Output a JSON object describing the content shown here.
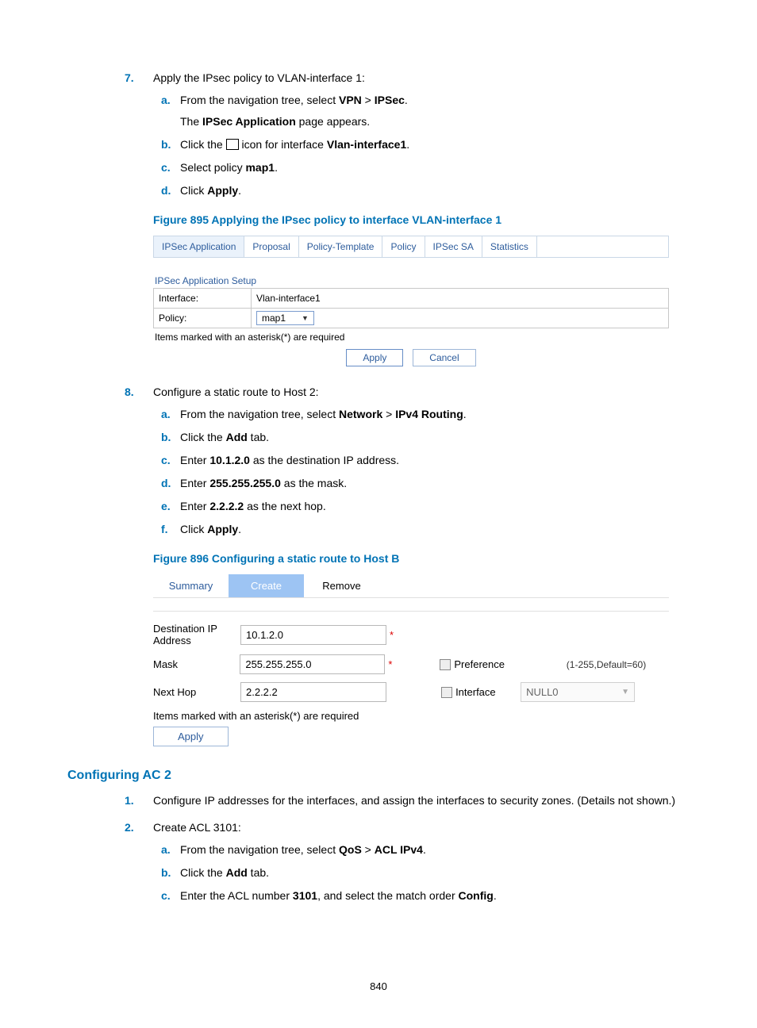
{
  "step7": {
    "number": "7.",
    "intro": "Apply the IPsec policy to VLAN-interface 1:",
    "a_pre": "From the navigation tree, select ",
    "a_b1": "VPN",
    "a_mid": " > ",
    "a_b2": "IPSec",
    "a_post": ".",
    "a_line2_pre": "The ",
    "a_line2_b": "IPSec Application",
    "a_line2_post": " page appears.",
    "b_pre": "Click the ",
    "b_mid": " icon for interface ",
    "b_b": "Vlan-interface1",
    "b_post": ".",
    "c_pre": "Select policy ",
    "c_b": "map1",
    "c_post": ".",
    "d_pre": "Click ",
    "d_b": "Apply",
    "d_post": "."
  },
  "fig895": {
    "caption": "Figure 895 Applying the IPsec policy to interface VLAN-interface 1",
    "tabs": [
      "IPSec Application",
      "Proposal",
      "Policy-Template",
      "Policy",
      "IPSec SA",
      "Statistics"
    ],
    "setup_title": "IPSec Application Setup",
    "row_interface_label": "Interface:",
    "row_interface_value": "Vlan-interface1",
    "row_policy_label": "Policy:",
    "row_policy_value": "map1",
    "note": "Items marked with an asterisk(*) are required",
    "apply": "Apply",
    "cancel": "Cancel"
  },
  "step8": {
    "number": "8.",
    "intro": "Configure a static route to Host 2:",
    "a_pre": "From the navigation tree, select ",
    "a_b1": "Network",
    "a_mid": " > ",
    "a_b2": "IPv4 Routing",
    "a_post": ".",
    "b_pre": "Click the ",
    "b_b": "Add",
    "b_post": " tab.",
    "c_pre": "Enter ",
    "c_b": "10.1.2.0",
    "c_post": " as the destination IP address.",
    "d_pre": "Enter ",
    "d_b": "255.255.255.0",
    "d_post": " as the mask.",
    "e_pre": "Enter ",
    "e_b": "2.2.2.2",
    "e_post": " as the next hop.",
    "f_pre": "Click ",
    "f_b": "Apply",
    "f_post": "."
  },
  "fig896": {
    "caption": "Figure 896 Configuring a static route to Host B",
    "tabs": {
      "summary": "Summary",
      "create": "Create",
      "remove": "Remove"
    },
    "dest_label": "Destination IP Address",
    "dest_value": "10.1.2.0",
    "mask_label": "Mask",
    "mask_value": "255.255.255.0",
    "nexthop_label": "Next Hop",
    "nexthop_value": "2.2.2.2",
    "pref_label": "Preference",
    "pref_hint": "(1-255,Default=60)",
    "iface_label": "Interface",
    "iface_value": "NULL0",
    "note": "Items marked with an asterisk(*) are required",
    "apply": "Apply"
  },
  "section2": {
    "title": "Configuring AC 2",
    "step1_num": "1.",
    "step1_text": "Configure IP addresses for the interfaces, and assign the interfaces to security zones. (Details not shown.)",
    "step2_num": "2.",
    "step2_intro": "Create ACL 3101:",
    "a_pre": "From the navigation tree, select ",
    "a_b1": "QoS",
    "a_mid": " > ",
    "a_b2": "ACL IPv4",
    "a_post": ".",
    "b_pre": "Click the ",
    "b_b": "Add",
    "b_post": " tab.",
    "c_pre": "Enter the ACL number ",
    "c_b1": "3101",
    "c_mid": ", and select the match order ",
    "c_b2": "Config",
    "c_post": "."
  },
  "page_number": "840"
}
